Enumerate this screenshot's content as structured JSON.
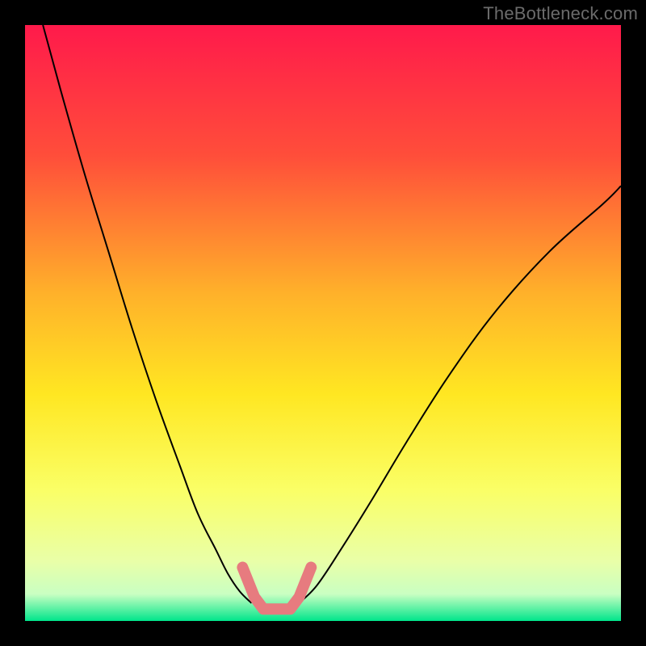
{
  "watermark": "TheBottleneck.com",
  "chart_data": {
    "type": "line",
    "title": "",
    "xlabel": "",
    "ylabel": "",
    "xlim": [
      0,
      100
    ],
    "ylim": [
      0,
      100
    ],
    "gradient_stops": [
      {
        "offset": 0.0,
        "color": "#ff1a4b"
      },
      {
        "offset": 0.22,
        "color": "#ff4e3a"
      },
      {
        "offset": 0.45,
        "color": "#ffb12a"
      },
      {
        "offset": 0.62,
        "color": "#ffe722"
      },
      {
        "offset": 0.78,
        "color": "#faff66"
      },
      {
        "offset": 0.9,
        "color": "#e9ffa8"
      },
      {
        "offset": 0.955,
        "color": "#c9ffc2"
      },
      {
        "offset": 1.0,
        "color": "#00e58b"
      }
    ],
    "series": [
      {
        "name": "left-curve",
        "stroke": "#000000",
        "stroke_width": 2,
        "x": [
          3,
          6,
          10,
          14,
          18,
          22,
          26,
          29,
          32,
          34,
          36,
          38
        ],
        "y": [
          100,
          89,
          75,
          62,
          49,
          37,
          26,
          18,
          12,
          8,
          5,
          3
        ]
      },
      {
        "name": "right-curve",
        "stroke": "#000000",
        "stroke_width": 2,
        "x": [
          46,
          49,
          53,
          58,
          64,
          71,
          79,
          88,
          97,
          100
        ],
        "y": [
          3,
          6,
          12,
          20,
          30,
          41,
          52,
          62,
          70,
          73
        ]
      },
      {
        "name": "bottom-highlight",
        "stroke": "#e77b7f",
        "stroke_width": 14,
        "linecap": "round",
        "x": [
          36.5,
          38.5,
          40.0,
          44.5,
          46.0,
          48.0
        ],
        "y": [
          9.0,
          4.0,
          2.0,
          2.0,
          4.0,
          9.0
        ]
      }
    ]
  }
}
